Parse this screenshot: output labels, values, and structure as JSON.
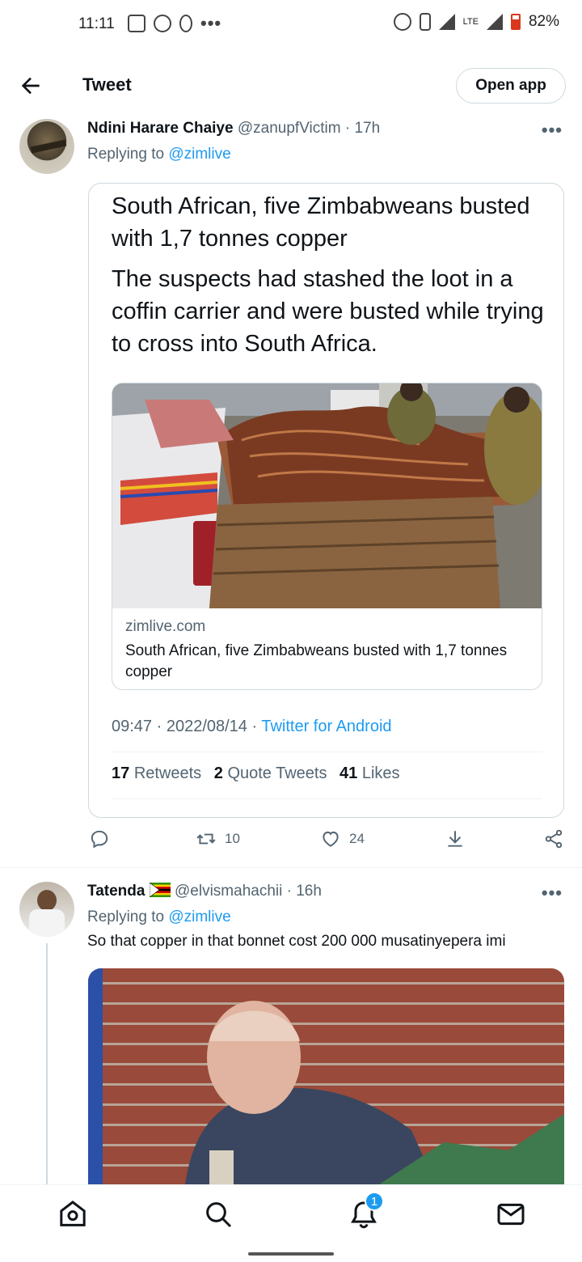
{
  "status_bar": {
    "time": "11:11",
    "network": "LTE",
    "battery": "82%"
  },
  "header": {
    "title": "Tweet",
    "open_app_label": "Open app"
  },
  "tweet1": {
    "name": "Ndini Harare Chaiye",
    "handle": "@zanupfVictim",
    "time": "17h",
    "replying_prefix": "Replying to",
    "replying_to": "@zimlive",
    "quoted": {
      "headline": "South African, five Zimbabweans busted with 1,7 tonnes copper",
      "summary": "The suspects had stashed the loot in a coffin carrier and were busted while trying to cross into South Africa.",
      "link_domain": "zimlive.com",
      "link_title": "South African, five Zimbabweans busted with 1,7 tonnes copper",
      "timestamp": "09:47 · 2022/08/14 ·",
      "source": "Twitter for Android",
      "retweets_count": "17",
      "retweets_label": "Retweets",
      "quotes_count": "2",
      "quotes_label": "Quote Tweets",
      "likes_count": "41",
      "likes_label": "Likes"
    },
    "actions": {
      "replies": "",
      "retweets": "10",
      "likes": "24"
    }
  },
  "tweet2": {
    "name": "Tatenda",
    "flag_icon": "zimbabwe-flag-icon",
    "handle": "@elvismahachii",
    "time": "16h",
    "replying_prefix": "Replying to",
    "replying_to": "@zimlive",
    "text": "So that copper in that bonnet cost 200 000 musatinyepera imi"
  },
  "bottom_nav": {
    "notifications_badge": "1"
  },
  "colors": {
    "accent": "#1d9bf0",
    "text": "#0f1419",
    "secondary": "#536471",
    "border": "#cfd9de"
  }
}
